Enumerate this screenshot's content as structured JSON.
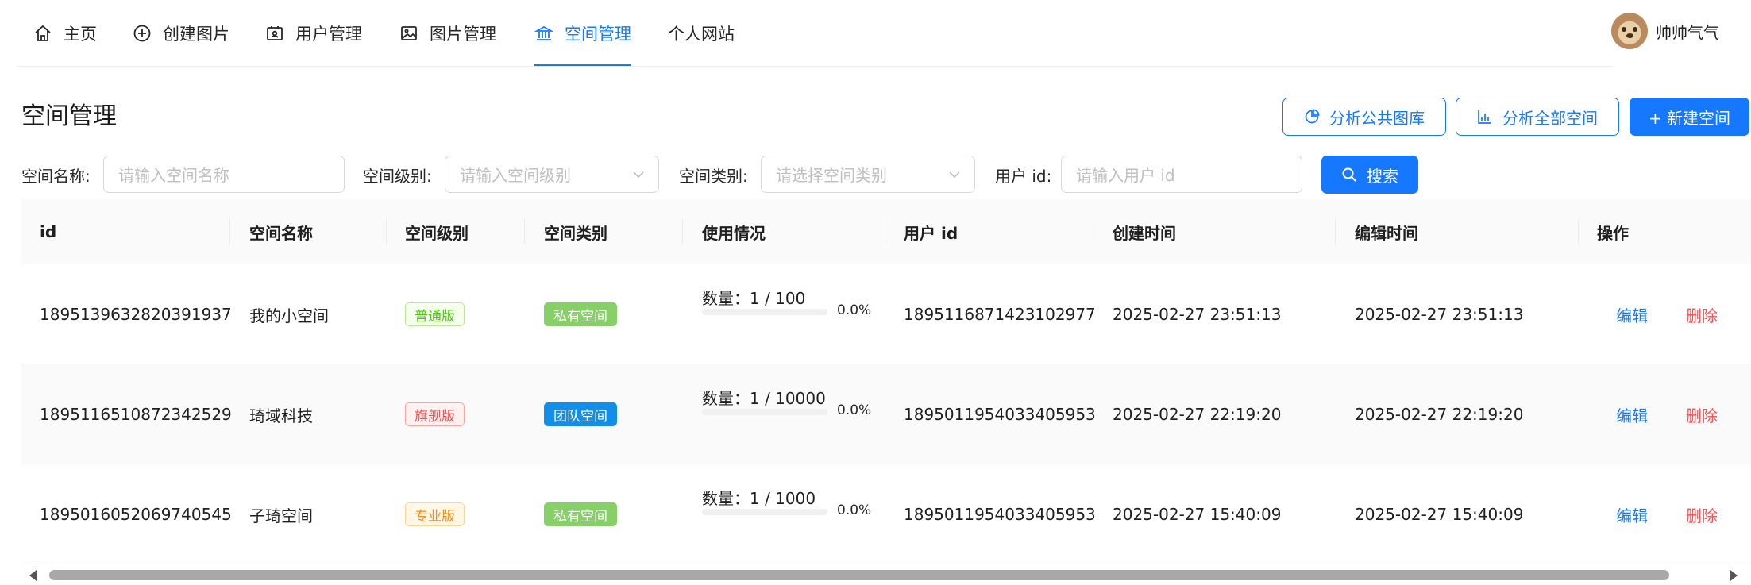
{
  "nav": {
    "items": [
      {
        "label": "主页",
        "icon": "home-icon"
      },
      {
        "label": "创建图片",
        "icon": "plus-circle-icon"
      },
      {
        "label": "用户管理",
        "icon": "user-card-icon"
      },
      {
        "label": "图片管理",
        "icon": "picture-icon"
      },
      {
        "label": "空间管理",
        "icon": "bank-icon",
        "active": true
      },
      {
        "label": "个人网站",
        "icon": ""
      }
    ],
    "user_name": "帅帅气气"
  },
  "page": {
    "title": "空间管理",
    "buttons": {
      "analyze_public": "分析公共图库",
      "analyze_all": "分析全部空间",
      "create": "+ 新建空间"
    }
  },
  "filters": {
    "space_name_label": "空间名称:",
    "space_name_placeholder": "请输入空间名称",
    "space_level_label": "空间级别:",
    "space_level_placeholder": "请输入空间级别",
    "space_type_label": "空间类别:",
    "space_type_placeholder": "请选择空间类别",
    "user_id_label": "用户 id:",
    "user_id_placeholder": "请输入用户 id",
    "search_label": "搜索"
  },
  "table": {
    "columns": [
      "id",
      "空间名称",
      "空间级别",
      "空间类别",
      "使用情况",
      "用户 id",
      "创建时间",
      "编辑时间",
      "操作"
    ],
    "rows": [
      {
        "id": "1895139632820391937",
        "name": "我的小空间",
        "level": "普通版",
        "type": "私有空间",
        "usage_count": "数量：1 / 100",
        "usage_percent": "0.0%",
        "usage_fraction": 0.0,
        "user_id": "1895116871423102977",
        "create_time": "2025-02-27 23:51:13",
        "edit_time": "2025-02-27 23:51:13",
        "edit": "编辑",
        "delete": "删除"
      },
      {
        "id": "1895116510872342529",
        "name": "琦域科技",
        "level": "旗舰版",
        "type": "团队空间",
        "usage_count": "数量：1 / 10000",
        "usage_percent": "0.0%",
        "usage_fraction": 0.0,
        "user_id": "1895011954033405953",
        "create_time": "2025-02-27 22:19:20",
        "edit_time": "2025-02-27 22:19:20",
        "edit": "编辑",
        "delete": "删除"
      },
      {
        "id": "1895016052069740545",
        "name": "子琦空间",
        "level": "专业版",
        "type": "私有空间",
        "usage_count": "数量：1 / 1000",
        "usage_percent": "0.0%",
        "usage_fraction": 0.0,
        "user_id": "1895011954033405953",
        "create_time": "2025-02-27 15:40:09",
        "edit_time": "2025-02-27 15:40:09",
        "edit": "编辑",
        "delete": "删除"
      }
    ]
  },
  "colors": {
    "primary": "#1677ff",
    "danger": "#ff4d4f"
  }
}
